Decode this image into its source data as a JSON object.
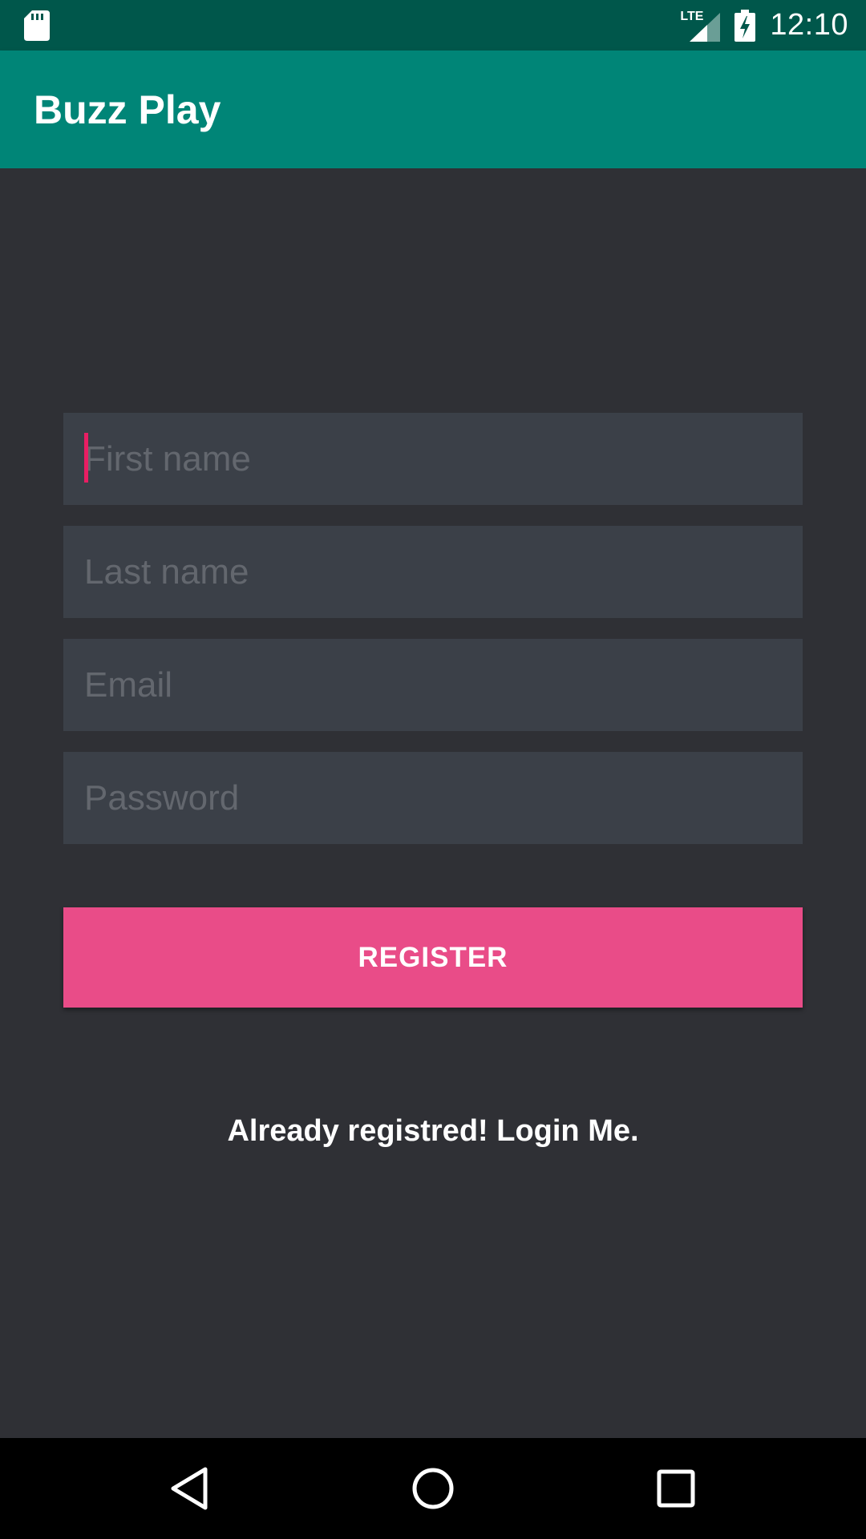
{
  "status_bar": {
    "network": "LTE",
    "time": "12:10",
    "icons": [
      "sd-card-icon",
      "lte-signal-icon",
      "battery-charging-icon"
    ]
  },
  "app_bar": {
    "title": "Buzz Play"
  },
  "form": {
    "first_name": {
      "placeholder": "First name",
      "value": ""
    },
    "last_name": {
      "placeholder": "Last name",
      "value": ""
    },
    "email": {
      "placeholder": "Email",
      "value": ""
    },
    "password": {
      "placeholder": "Password",
      "value": ""
    },
    "register_label": "REGISTER",
    "login_link": "Already registred! Login Me."
  },
  "nav_bar": {
    "icons": [
      "back-icon",
      "home-icon",
      "recents-icon"
    ]
  },
  "colors": {
    "status_bar": "#00574b",
    "app_bar": "#008577",
    "background": "#2f3035",
    "field": "#3b4048",
    "accent": "#e94c88",
    "cursor": "#e91e63"
  }
}
